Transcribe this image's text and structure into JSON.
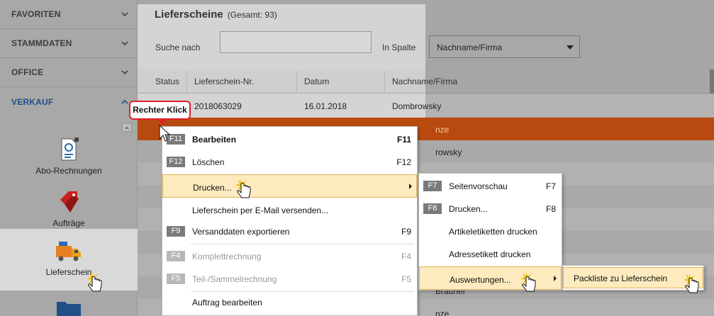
{
  "sidebar": {
    "sections": [
      {
        "label": "FAVORITEN"
      },
      {
        "label": "STAMMDATEN"
      },
      {
        "label": "OFFICE"
      },
      {
        "label": "VERKAUF"
      }
    ],
    "items": [
      {
        "label": "Abo-Rechnungen",
        "icon": "invoice-icon"
      },
      {
        "label": "Aufträge",
        "icon": "tag-icon"
      },
      {
        "label": "Lieferschein",
        "icon": "delivery-truck-icon"
      }
    ]
  },
  "main": {
    "title": "Lieferscheine",
    "subtitle": "(Gesamt: 93)",
    "search_label": "Suche nach",
    "search_value": "",
    "column_label": "In Spalte",
    "column_select": "Nachname/Firma"
  },
  "table": {
    "headers": [
      "Status",
      "Lieferschein-Nr.",
      "Datum",
      "Nachname/Firma"
    ],
    "rows": [
      {
        "nr": "2018063029",
        "datum": "16.01.2018",
        "name": "Dombrowsky"
      },
      {
        "name_partial": "nze"
      },
      {
        "name_partial": "rowsky"
      },
      {
        "name_partial": "Brauner"
      },
      {
        "name_partial": "nze"
      }
    ]
  },
  "callout": "Rechter Klick",
  "context_menu": [
    {
      "key": "F11",
      "label": "Bearbeiten",
      "shortcut": "F11",
      "bold": true
    },
    {
      "key": "F12",
      "label": "Löschen",
      "shortcut": "F12"
    },
    {
      "key": "",
      "label": "Drucken...",
      "shortcut": "",
      "submenu": true
    },
    {
      "key": "",
      "label": "Lieferschein per E-Mail versenden...",
      "shortcut": ""
    },
    {
      "key": "F9",
      "label": "Versanddaten exportieren",
      "shortcut": "F9"
    },
    {
      "key": "F4",
      "label": "Komplettrechnung",
      "shortcut": "F4",
      "disabled": true
    },
    {
      "key": "F5",
      "label": "Teil-/Sammelrechnung",
      "shortcut": "F5",
      "disabled": true
    },
    {
      "key": "",
      "label": "Auftrag bearbeiten",
      "shortcut": ""
    }
  ],
  "print_menu": [
    {
      "key": "F7",
      "label": "Seitenvorschau",
      "shortcut": "F7"
    },
    {
      "key": "F8",
      "label": "Drucken...",
      "shortcut": "F8"
    },
    {
      "key": "",
      "label": "Artikeletiketten drucken",
      "shortcut": ""
    },
    {
      "key": "",
      "label": "Adressetikett drucken",
      "shortcut": ""
    },
    {
      "key": "",
      "label": "Auswertungen...",
      "shortcut": "",
      "submenu": true
    }
  ],
  "report_menu": [
    {
      "label": "Packliste zu Lieferschein"
    }
  ],
  "colors": {
    "accent": "#1f4f86",
    "selected_row": "#b84a0f",
    "highlight": "#fdebbf",
    "callout_border": "#e0202a"
  }
}
